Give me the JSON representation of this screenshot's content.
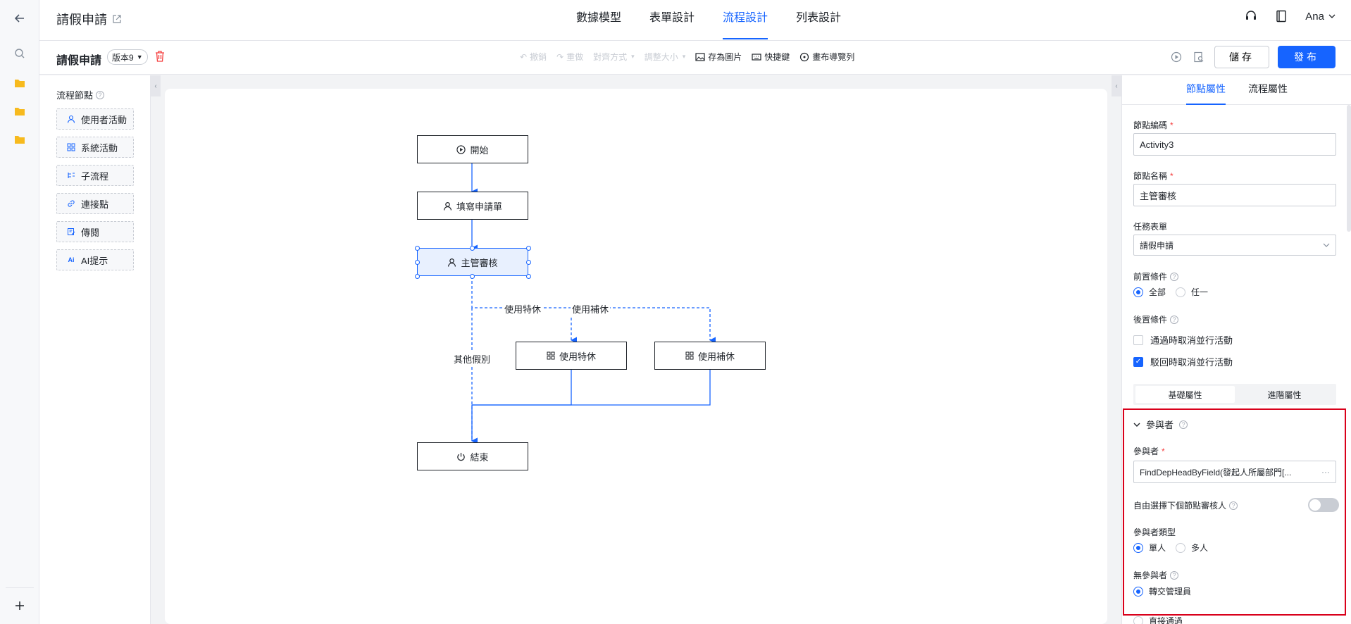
{
  "app": {
    "title": "請假申請",
    "user": "Ana"
  },
  "tabs": [
    "數據模型",
    "表單設計",
    "流程設計",
    "列表設計"
  ],
  "toolbar": {
    "process_name": "請假申請",
    "version": "版本9",
    "undo": "撤銷",
    "redo": "重做",
    "align": "對齊方式",
    "resize": "調整大小",
    "save_image": "存為圖片",
    "shortcuts": "快捷鍵",
    "minimap": "畫布導覽列",
    "save": "儲存",
    "publish": "發布"
  },
  "palette": {
    "title": "流程節點",
    "items": [
      "使用者活動",
      "系統活動",
      "子流程",
      "連接點",
      "傳閱",
      "AI提示"
    ]
  },
  "flow": {
    "nodes": {
      "start": "開始",
      "fill": "填寫申請單",
      "review": "主管審核",
      "special": "使用特休",
      "comp": "使用補休",
      "end": "結束"
    },
    "edges": {
      "special": "使用特休",
      "comp": "使用補休",
      "other": "其他假別"
    }
  },
  "props": {
    "tabs": [
      "節點屬性",
      "流程屬性"
    ],
    "node_code_label": "節點編碼",
    "node_code": "Activity3",
    "node_name_label": "節點名稱",
    "node_name": "主管審核",
    "task_form_label": "任務表單",
    "task_form": "請假申請",
    "pre_cond_label": "前置條件",
    "pre_all": "全部",
    "pre_any": "任一",
    "post_cond_label": "後置條件",
    "post_opt1": "通過時取消並行活動",
    "post_opt2": "駁回時取消並行活動",
    "seg_basic": "基礎屬性",
    "seg_adv": "進階屬性",
    "participants_section": "參與者",
    "participant_label": "參與者",
    "participant_value": "FindDepHeadByField(發起人所屬部門[...",
    "free_select_label": "自由選擇下個節點審核人",
    "ptype_label": "參與者類型",
    "ptype_single": "單人",
    "ptype_multi": "多人",
    "no_part_label": "無參與者",
    "no_part_opt": "轉交管理員",
    "no_part_opt2": "直接通過"
  },
  "colors": {
    "accent": "#1664ff",
    "danger": "#f53f3f",
    "highlight_box": "#d9001b"
  }
}
